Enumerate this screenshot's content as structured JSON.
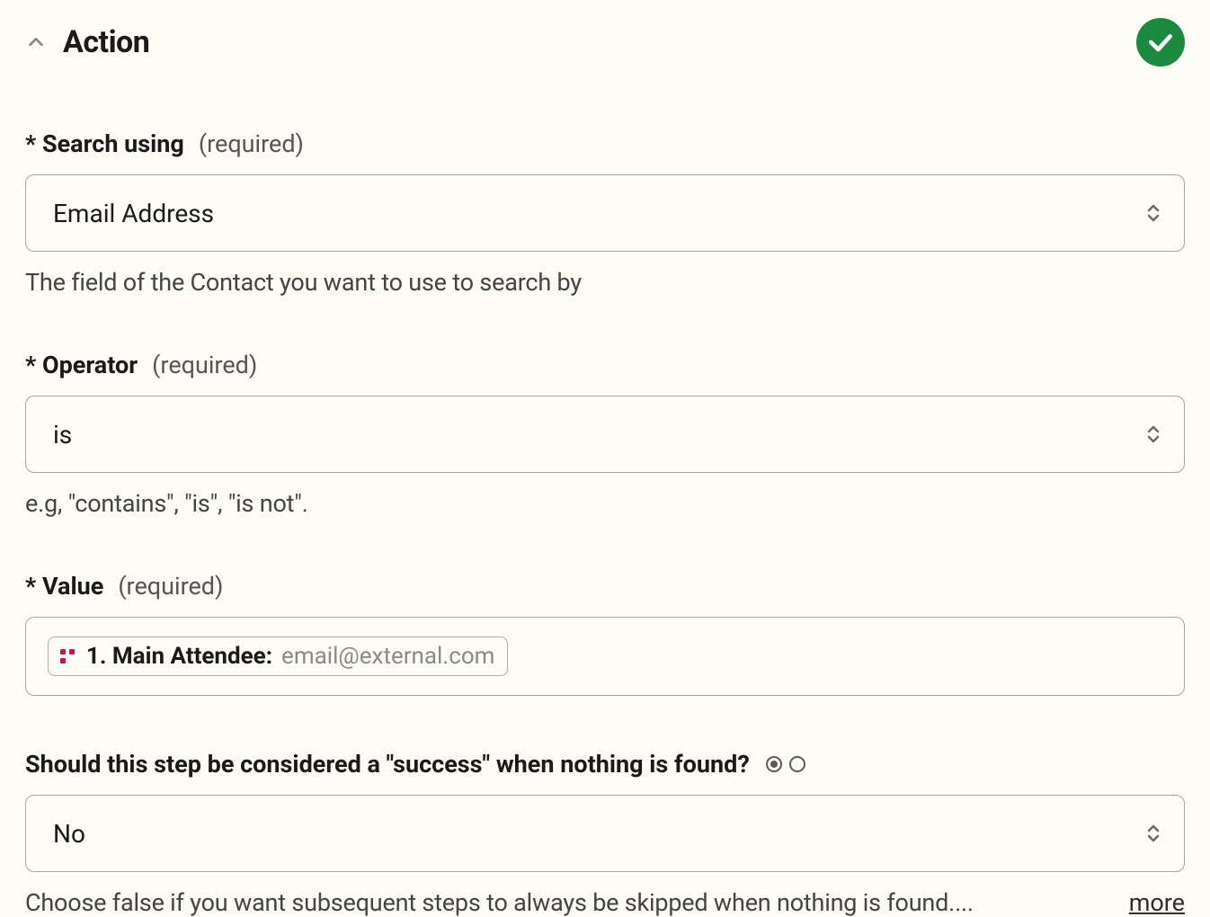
{
  "section": {
    "title": "Action"
  },
  "fields": {
    "searchUsing": {
      "label": "* Search using",
      "required": "(required)",
      "value": "Email Address",
      "help": "The field of the Contact you want to use to search by"
    },
    "operator": {
      "label": "* Operator",
      "required": "(required)",
      "value": "is",
      "help": "e.g, \"contains\", \"is\", \"is not\"."
    },
    "value": {
      "label": "* Value",
      "required": "(required)",
      "chipLabel": "1. Main Attendee:",
      "chipSub": " email@external.com"
    },
    "success": {
      "label": "Should this step be considered a \"success\" when nothing is found?",
      "value": "No",
      "help": "Choose false if you want subsequent steps to always be skipped when nothing is found....",
      "more": "more"
    }
  }
}
